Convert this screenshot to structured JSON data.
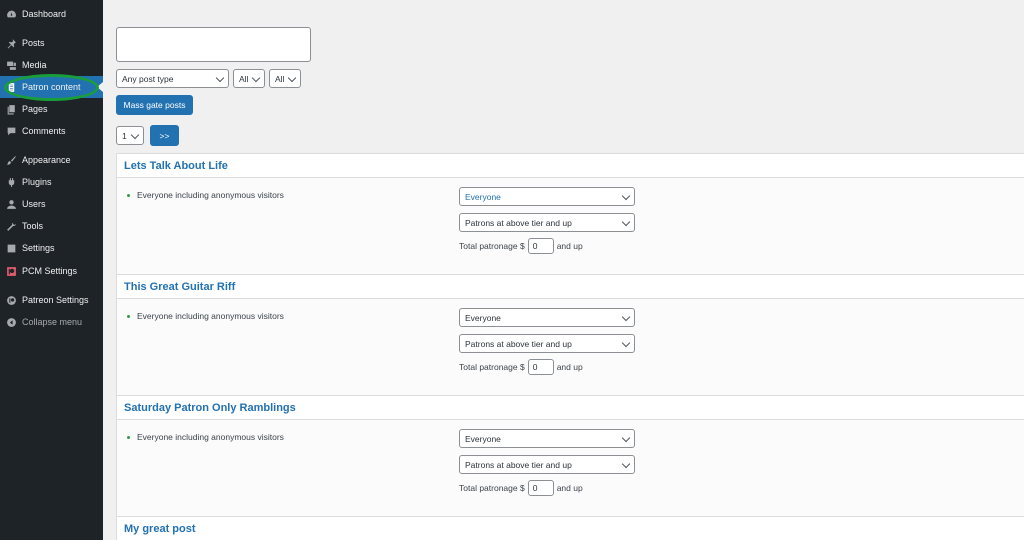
{
  "sidebar": {
    "items": [
      {
        "label": "Dashboard",
        "icon": "dashboard-icon"
      },
      {
        "label": "Posts",
        "icon": "pin-icon"
      },
      {
        "label": "Media",
        "icon": "media-icon"
      },
      {
        "label": "Patron content",
        "icon": "document-icon",
        "active": true
      },
      {
        "label": "Pages",
        "icon": "pages-icon"
      },
      {
        "label": "Comments",
        "icon": "comment-icon"
      },
      {
        "label": "Appearance",
        "icon": "brush-icon"
      },
      {
        "label": "Plugins",
        "icon": "plug-icon"
      },
      {
        "label": "Users",
        "icon": "user-icon"
      },
      {
        "label": "Tools",
        "icon": "wrench-icon"
      },
      {
        "label": "Settings",
        "icon": "settings-icon"
      },
      {
        "label": "PCM Settings",
        "icon": "patreon-square-icon"
      },
      {
        "label": "Patreon Settings",
        "icon": "patreon-circle-icon"
      },
      {
        "label": "Collapse menu",
        "icon": "collapse-icon"
      }
    ]
  },
  "filters": {
    "post_type": "Any post type",
    "filter2": "All",
    "filter3": "All",
    "mass_gate_label": "Mass gate posts",
    "page": "1",
    "next_label": ">>"
  },
  "posts": [
    {
      "title": "Lets Talk About Life",
      "visibility": "Everyone including anonymous visitors",
      "audience": "Everyone",
      "tier": "Patrons at above tier and up",
      "total_label": "Total patronage $",
      "total_value": "0",
      "total_suffix": "and up"
    },
    {
      "title": "This Great Guitar Riff",
      "visibility": "Everyone including anonymous visitors",
      "audience": "Everyone",
      "tier": "Patrons at above tier and up",
      "total_label": "Total patronage $",
      "total_value": "0",
      "total_suffix": "and up"
    },
    {
      "title": "Saturday Patron Only Ramblings",
      "visibility": "Everyone including anonymous visitors",
      "audience": "Everyone",
      "tier": "Patrons at above tier and up",
      "total_label": "Total patronage $",
      "total_value": "0",
      "total_suffix": "and up"
    },
    {
      "title": "My great post"
    }
  ],
  "colors": {
    "sidebar_bg": "#1d2327",
    "accent": "#2271b1",
    "highlight_ring": "#1a9e3b"
  }
}
